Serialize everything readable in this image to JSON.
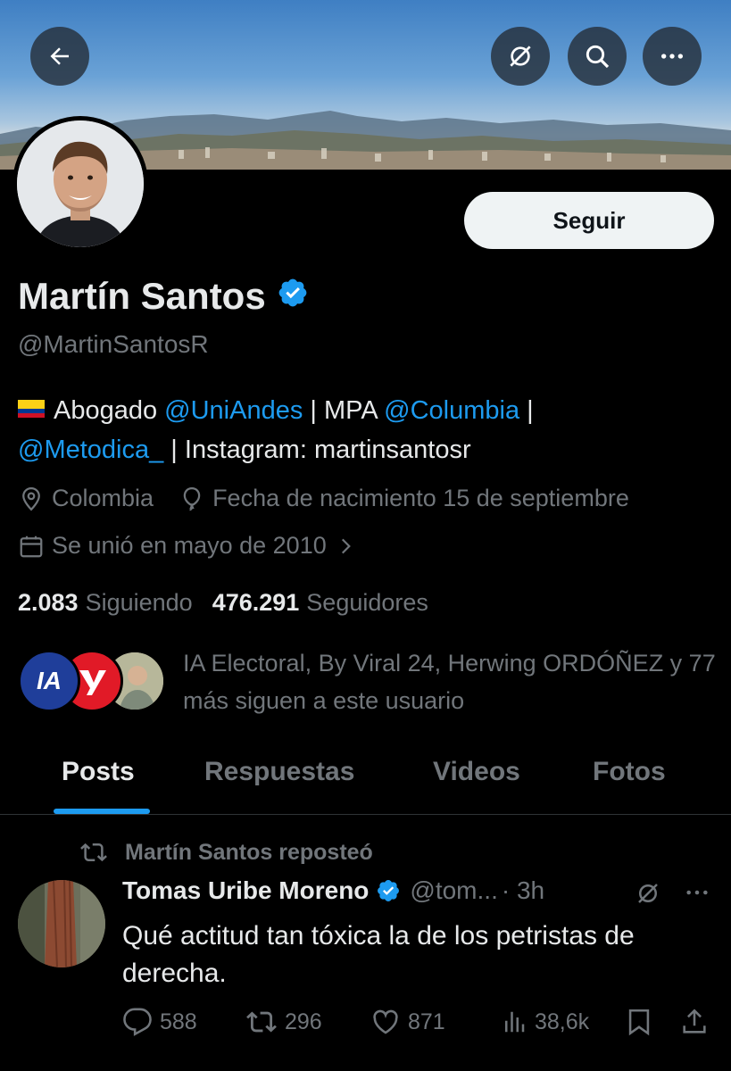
{
  "profile": {
    "name": "Martín Santos",
    "handle": "@MartinSantosR",
    "follow_label": "Seguir",
    "bio": {
      "p1": "Abogado ",
      "link1": "@UniAndes",
      "p2": " | MPA ",
      "link2": "@Columbia",
      "p3": " |",
      "link3": "@Metodica_",
      "p4": " | Instagram: martinsantosr"
    },
    "location": "Colombia",
    "birthday": "Fecha de nacimiento 15 de septiembre",
    "joined": "Se unió en mayo de 2010",
    "following_count": "2.083",
    "following_label": "Siguiendo",
    "followers_count": "476.291",
    "followers_label": "Seguidores",
    "followed_by_text": "IA Electoral, By Viral 24, Herwing ORDÓÑEZ y 77 más siguen a este usuario",
    "followed_by_logo_text": "IA"
  },
  "tabs": [
    {
      "label": "Posts",
      "active": true
    },
    {
      "label": "Respuestas",
      "active": false
    },
    {
      "label": "Videos",
      "active": false
    },
    {
      "label": "Fotos",
      "active": false
    }
  ],
  "post": {
    "repost_label": "Martín Santos reposteó",
    "author_name": "Tomas Uribe Moreno",
    "author_handle": "@tom...",
    "time": "· 3h",
    "text": "Qué actitud tan tóxica la de los petristas de derecha.",
    "replies": "588",
    "reposts": "296",
    "likes": "871",
    "views": "38,6k"
  },
  "colors": {
    "accent": "#1d9bf0",
    "background": "#000000",
    "muted": "#71767b",
    "text": "#e7e9ea"
  },
  "icons": [
    "back-arrow-icon",
    "grok-icon",
    "search-icon",
    "more-icon",
    "verified-badge-icon",
    "location-icon",
    "birthday-balloon-icon",
    "calendar-icon",
    "chevron-right-icon",
    "repost-icon",
    "reply-icon",
    "like-icon",
    "views-icon",
    "bookmark-icon",
    "share-icon"
  ]
}
